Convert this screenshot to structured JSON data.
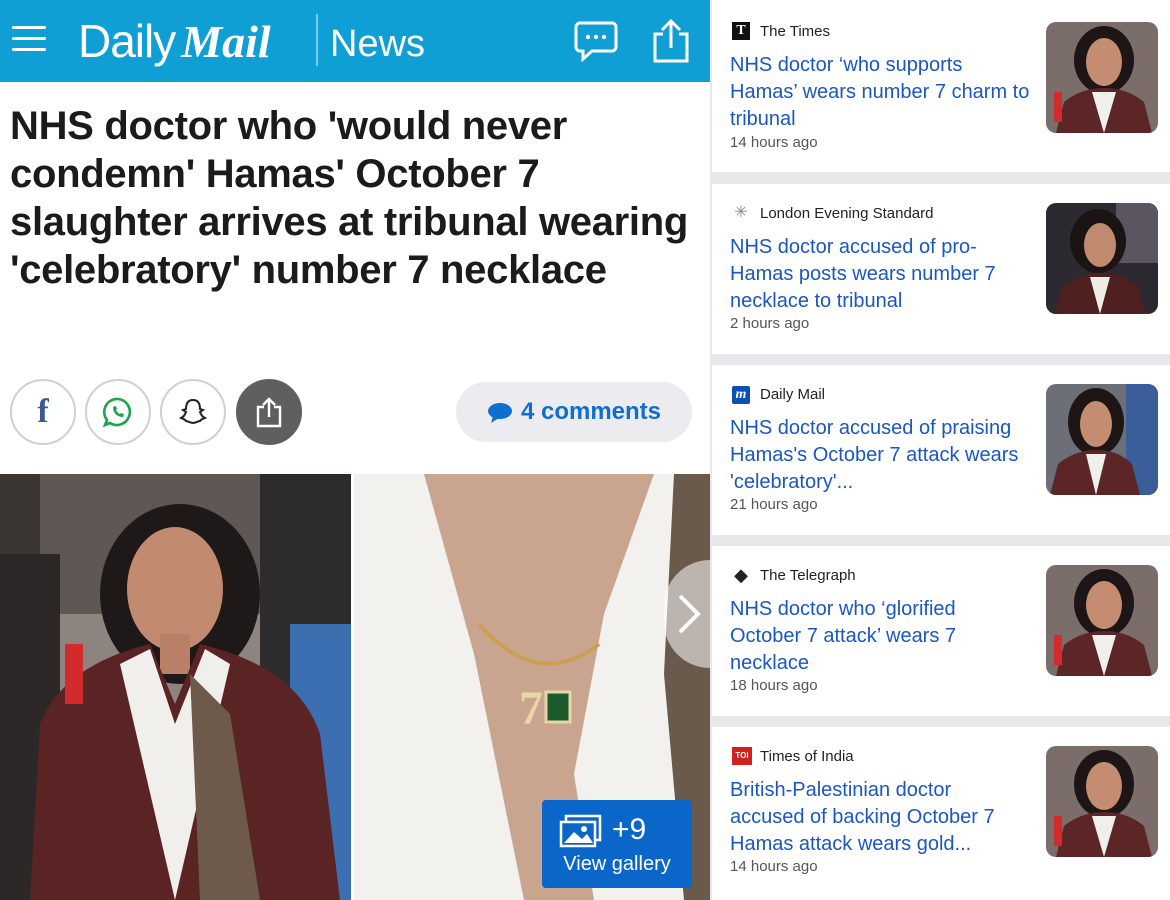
{
  "header": {
    "logo_daily": "Daily",
    "logo_mail": "Mail",
    "section": "News",
    "bar_color": "#0f9fd4"
  },
  "article": {
    "headline": "NHS doctor who 'would never condemn' Hamas' October 7 slaughter arrives at tribunal wearing 'celebratory' number 7 necklace",
    "comments": "4 comments",
    "share_icons": [
      "facebook-icon",
      "whatsapp-icon",
      "snapchat-icon",
      "share-icon"
    ],
    "gallery_count": "+9",
    "gallery_label": "View gallery"
  },
  "related": [
    {
      "source": "The Times",
      "source_icon": "T",
      "title": "NHS doctor ‘who supports Hamas’ wears number 7 charm to tribunal",
      "time": "14 hours ago"
    },
    {
      "source": "London Evening Standard",
      "source_icon": "✳",
      "title": "NHS doctor accused of pro-Hamas posts wears number 7 necklace to tribunal",
      "time": "2 hours ago"
    },
    {
      "source": "Daily Mail",
      "source_icon": "m",
      "title": "NHS doctor accused of praising Hamas's October 7 attack wears 'celebratory'...",
      "time": "21 hours ago"
    },
    {
      "source": "The Telegraph",
      "source_icon": "◆",
      "title": "NHS doctor who ‘glorified October 7 attack’ wears 7 necklace",
      "time": "18 hours ago"
    },
    {
      "source": "Times of India",
      "source_icon": "TOI",
      "title": "British-Palestinian doctor accused of backing October 7 Hamas attack wears gold...",
      "time": "14 hours ago"
    }
  ],
  "colors": {
    "link": "#1a56c4",
    "brand_blue": "#0f9fd4",
    "gallery_blue": "#0b66c9"
  }
}
